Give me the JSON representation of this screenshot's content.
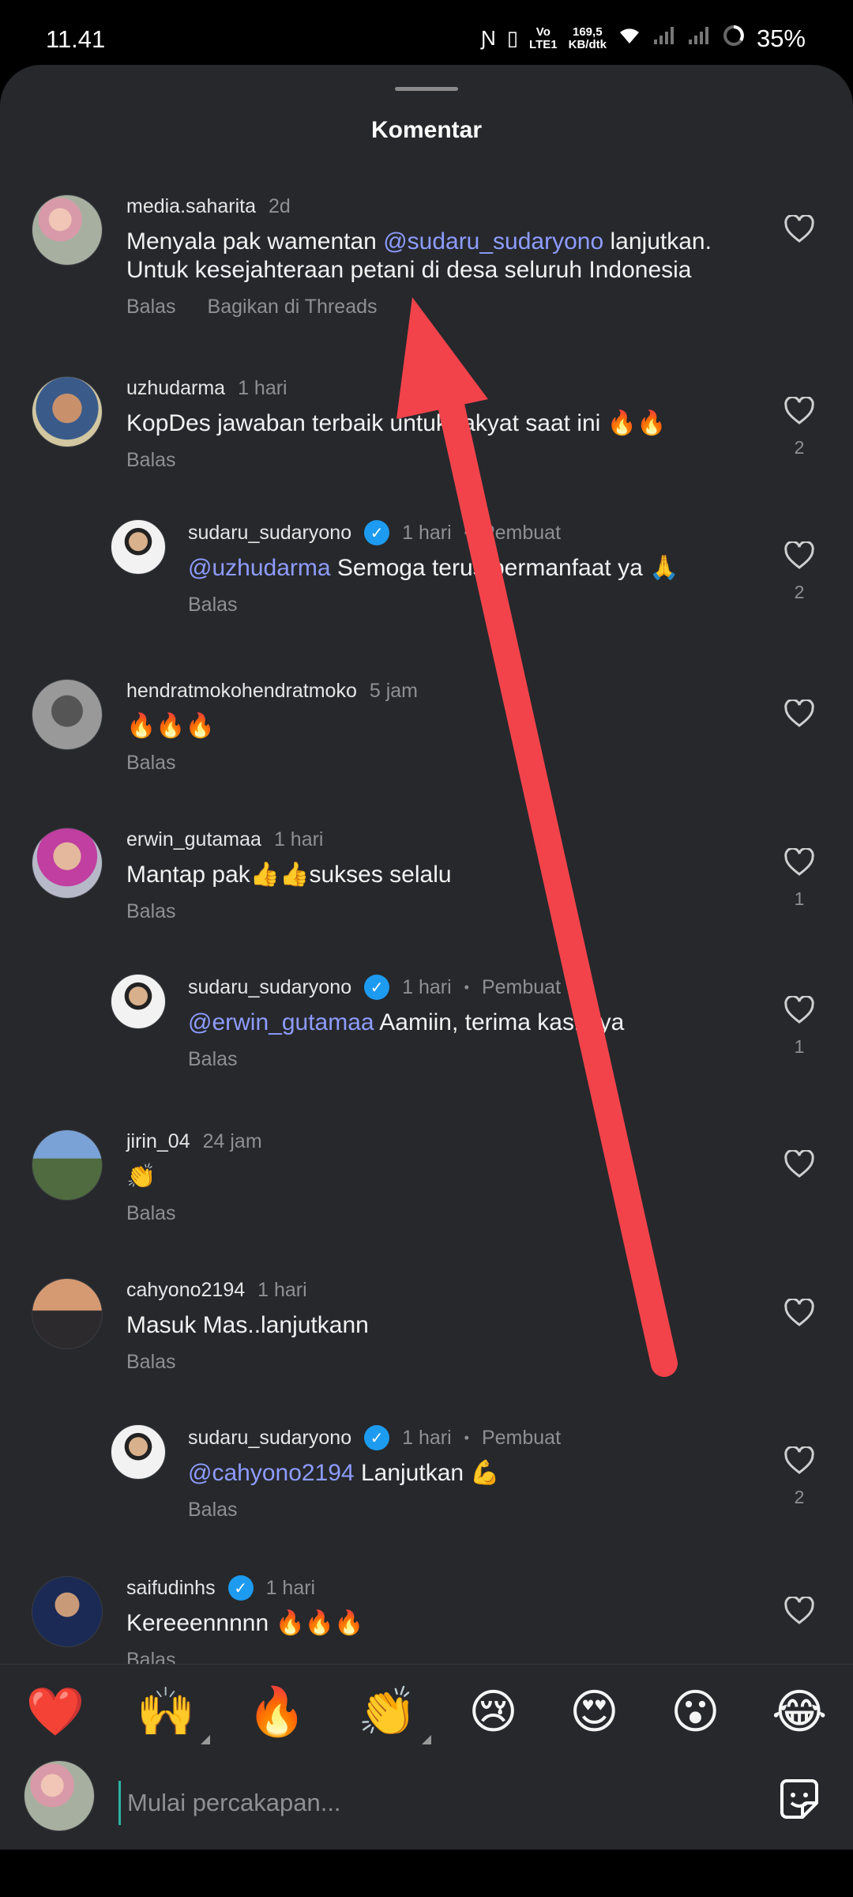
{
  "status_bar": {
    "time": "11.41",
    "net_speed_top": "169,5",
    "net_speed_bottom": "KB/dtk",
    "battery": "35%",
    "icons": [
      "nfc-icon",
      "vibrate-icon",
      "volte-icon",
      "wifi-icon",
      "signal-icon",
      "signal-icon",
      "battery-icon"
    ]
  },
  "sheet": {
    "title": "Komentar"
  },
  "comments": [
    {
      "username": "media.saharita",
      "time": "2d",
      "text_parts": [
        {
          "t": "Menyala pak wamentan "
        },
        {
          "t": "@sudaru_sudaryono",
          "m": true
        },
        {
          "t": " lanjutkan. Untuk kesejahteraan petani di desa seluruh Indonesia"
        }
      ],
      "reply": "Balas",
      "share": "Bagikan di Threads",
      "likes": ""
    },
    {
      "username": "uzhudarma",
      "time": "1 hari",
      "text_parts": [
        {
          "t": "KopDes jawaban terbaik untuk rakyat saat ini 🔥🔥"
        }
      ],
      "reply": "Balas",
      "likes": "2"
    },
    {
      "username": "sudaru_sudaryono",
      "verified": true,
      "time": "1 hari",
      "creator": "Pembuat",
      "nested": true,
      "text_parts": [
        {
          "t": "@uzhudarma",
          "m": true
        },
        {
          "t": " Semoga terus bermanfaat ya 🙏"
        }
      ],
      "reply": "Balas",
      "likes": "2"
    },
    {
      "username": "hendratmokohendratmoko",
      "time": "5 jam",
      "text_parts": [
        {
          "t": "🔥🔥🔥"
        }
      ],
      "reply": "Balas",
      "likes": ""
    },
    {
      "username": "erwin_gutamaa",
      "time": "1 hari",
      "text_parts": [
        {
          "t": "Mantap pak👍👍sukses selalu"
        }
      ],
      "reply": "Balas",
      "likes": "1"
    },
    {
      "username": "sudaru_sudaryono",
      "verified": true,
      "time": "1 hari",
      "creator": "Pembuat",
      "nested": true,
      "text_parts": [
        {
          "t": "@erwin_gutamaa",
          "m": true
        },
        {
          "t": " Aamiin, terima kasih ya"
        }
      ],
      "reply": "Balas",
      "likes": "1"
    },
    {
      "username": "jirin_04",
      "time": "24 jam",
      "text_parts": [
        {
          "t": "👏"
        }
      ],
      "reply": "Balas",
      "likes": ""
    },
    {
      "username": "cahyono2194",
      "time": "1 hari",
      "text_parts": [
        {
          "t": "Masuk Mas..lanjutkann"
        }
      ],
      "reply": "Balas",
      "likes": ""
    },
    {
      "username": "sudaru_sudaryono",
      "verified": true,
      "time": "1 hari",
      "creator": "Pembuat",
      "nested": true,
      "text_parts": [
        {
          "t": "@cahyono2194",
          "m": true
        },
        {
          "t": " Lanjutkan 💪"
        }
      ],
      "reply": "Balas",
      "likes": "2"
    },
    {
      "username": "saifudinhs",
      "verified": true,
      "time": "1 hari",
      "text_parts": [
        {
          "t": "Kereeennnnn 🔥🔥🔥"
        }
      ],
      "reply": "Balas",
      "likes": ""
    }
  ],
  "emoji_bar": [
    "❤️",
    "🙌",
    "🔥",
    "👏",
    "😢",
    "😍",
    "😮",
    "😂"
  ],
  "composer": {
    "placeholder": "Mulai percakapan..."
  },
  "colors": {
    "sheet_bg": "#26282c",
    "mention": "#8e9cff",
    "arrow": "#f2434b",
    "verified": "#1d9bf0"
  }
}
